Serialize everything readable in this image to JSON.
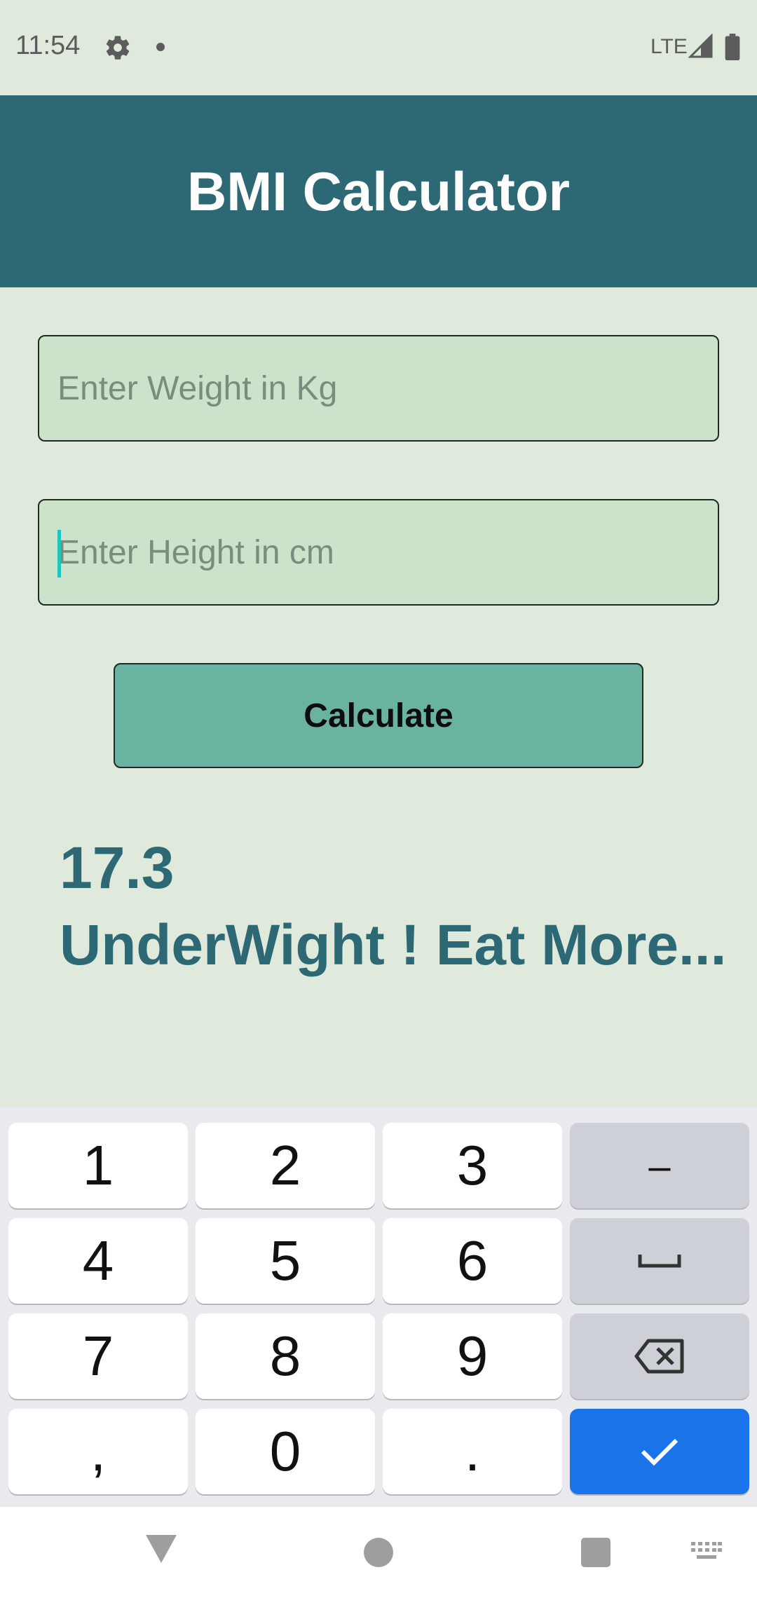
{
  "status_bar": {
    "time": "11:54",
    "network": "LTE",
    "icons": [
      "gear-icon",
      "notification-dot",
      "signal-icon",
      "battery-icon"
    ]
  },
  "app_bar": {
    "title": "BMI Calculator",
    "color": "#2d6974"
  },
  "form": {
    "weight": {
      "placeholder": "Enter Weight in Kg",
      "value": ""
    },
    "height": {
      "placeholder": "Enter Height in cm",
      "value": ""
    },
    "calculate_label": "Calculate"
  },
  "result": {
    "bmi": "17.3",
    "message": "UnderWight ! Eat More..."
  },
  "keyboard": {
    "keys": [
      "1",
      "2",
      "3",
      "–",
      "4",
      "5",
      "6",
      "7",
      "8",
      "9",
      ",",
      "0",
      "."
    ],
    "special_keys": [
      "space-icon",
      "backspace-icon",
      "checkmark-icon"
    ],
    "accent": "#1a73e8"
  },
  "nav_bar": {
    "icons": [
      "back-icon",
      "home-icon",
      "recents-icon",
      "keyboard-switch-icon"
    ]
  }
}
